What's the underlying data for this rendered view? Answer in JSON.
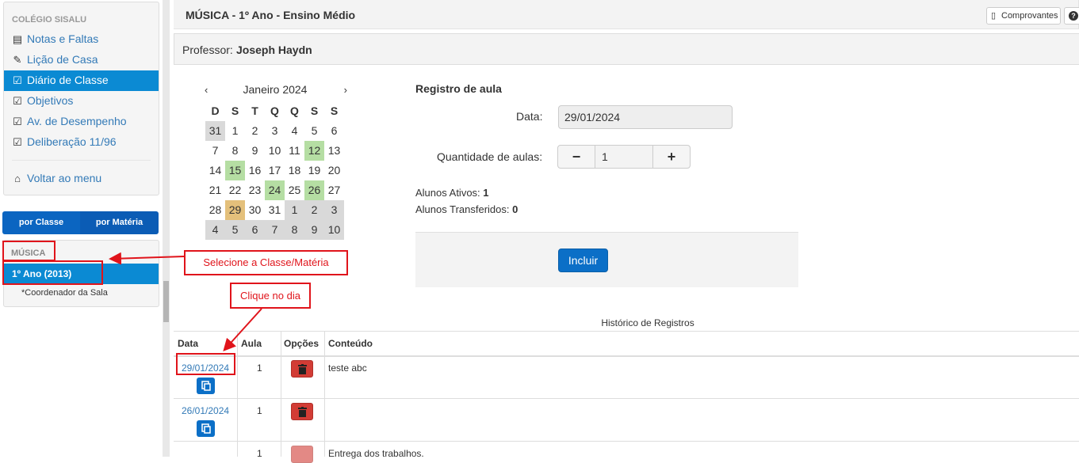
{
  "sidebar": {
    "school": "COLÉGIO SISALU",
    "items": [
      {
        "label": "Notas e Faltas",
        "icon": "list-icon"
      },
      {
        "label": "Lição de Casa",
        "icon": "pencil-icon"
      },
      {
        "label": "Diário de Classe",
        "icon": "check-square-icon"
      },
      {
        "label": "Objetivos",
        "icon": "check-square-icon"
      },
      {
        "label": "Av. de Desempenho",
        "icon": "check-square-icon"
      },
      {
        "label": "Deliberação 11/96",
        "icon": "check-square-icon"
      }
    ],
    "back_label": "Voltar ao menu",
    "toggle": {
      "by_class": "por Classe",
      "by_subject": "por Matéria"
    },
    "subject": "MÚSICA",
    "class_item": "1º Ano (2013)",
    "coordinator": "*Coordenador da Sala"
  },
  "header": {
    "title": "MÚSICA - 1º Ano - Ensino Médio",
    "receipts_label": "Comprovantes",
    "help_label": "?"
  },
  "professor": {
    "label": "Professor:",
    "name": "Joseph Haydn"
  },
  "calendar": {
    "month": "Janeiro 2024",
    "prev": "‹",
    "next": "›",
    "weekdays": [
      "D",
      "S",
      "T",
      "Q",
      "Q",
      "S",
      "S"
    ],
    "weeks": [
      [
        "31",
        "1",
        "2",
        "3",
        "4",
        "5",
        "6"
      ],
      [
        "7",
        "8",
        "9",
        "10",
        "11",
        "12",
        "13"
      ],
      [
        "14",
        "15",
        "16",
        "17",
        "18",
        "19",
        "20"
      ],
      [
        "21",
        "22",
        "23",
        "24",
        "25",
        "26",
        "27"
      ],
      [
        "28",
        "29",
        "30",
        "31",
        "1",
        "2",
        "3"
      ],
      [
        "4",
        "5",
        "6",
        "7",
        "8",
        "9",
        "10"
      ]
    ],
    "green_days": [
      "12",
      "15",
      "24",
      "26"
    ],
    "selected_day": "29",
    "colors": {
      "other_month": "#d9d9d9",
      "green": "#b5dea3",
      "selected": "#e4c07b"
    }
  },
  "registro": {
    "title": "Registro de aula",
    "date_label": "Data:",
    "date_value": "29/01/2024",
    "qty_label": "Quantidade de aulas:",
    "qty_value": "1",
    "minus": "−",
    "plus": "+",
    "active_label": "Alunos Ativos:",
    "active_value": "1",
    "transferred_label": "Alunos Transferidos:",
    "transferred_value": "0",
    "include_label": "Incluir"
  },
  "history": {
    "title": "Histórico de Registros",
    "columns": [
      "Data",
      "Aula",
      "Opções",
      "Conteúdo"
    ],
    "rows": [
      {
        "date": "29/01/2024",
        "aula": "1",
        "conteudo": "teste abc"
      },
      {
        "date": "26/01/2024",
        "aula": "1",
        "conteudo": ""
      },
      {
        "date": "",
        "aula": "1",
        "conteudo": "Entrega dos trabalhos."
      }
    ]
  },
  "annotations": {
    "select_class": "Selecione a Classe/Matéria",
    "click_day": "Clique no dia"
  },
  "colors": {
    "accent": "#0b8ad3",
    "primary_btn": "#0b6fc7",
    "danger": "#d23c35",
    "annotation": "#e0141b"
  }
}
